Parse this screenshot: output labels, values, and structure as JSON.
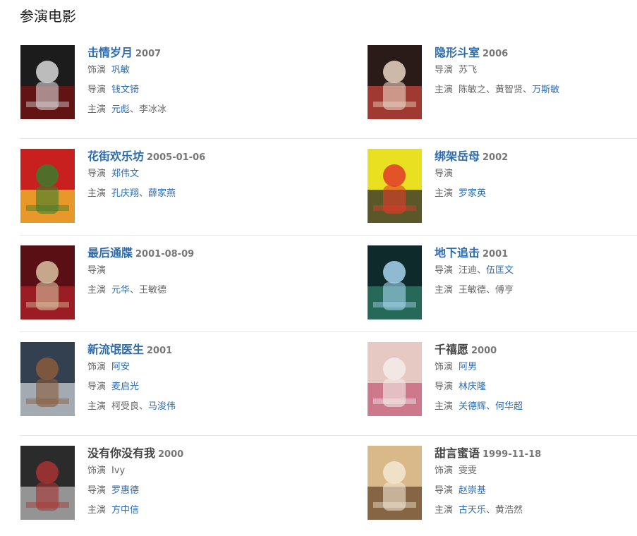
{
  "section_title": "参演电影",
  "rows": [
    {
      "items": [
        {
          "poster_icon": "movie-poster-icon",
          "poster_colors": [
            "#1c1c1c",
            "#7a1010",
            "#d8d8d8"
          ],
          "title": "击情岁月",
          "title_is_link": true,
          "year": "2007",
          "roles": [
            {
              "label": "饰演",
              "people": [
                {
                  "name": "巩敏",
                  "link": true
                }
              ]
            },
            {
              "label": "导演",
              "people": [
                {
                  "name": "钱文锜",
                  "link": true
                }
              ]
            },
            {
              "label": "主演",
              "people": [
                {
                  "name": "元彪",
                  "link": true
                },
                {
                  "name": "李冰冰",
                  "link": false
                }
              ]
            }
          ]
        },
        {
          "poster_icon": "movie-poster-icon",
          "poster_colors": [
            "#2a1a18",
            "#c8443a",
            "#e9d6c4"
          ],
          "title": "隐形斗室",
          "title_is_link": true,
          "year": "2006",
          "roles": [
            {
              "label": "导演",
              "people": [
                {
                  "name": "苏飞",
                  "link": false
                }
              ]
            },
            {
              "label": "主演",
              "people": [
                {
                  "name": "陈敏之",
                  "link": false
                },
                {
                  "name": "黄智贤",
                  "link": false
                },
                {
                  "name": "万斯敏",
                  "link": true
                }
              ]
            }
          ]
        }
      ]
    },
    {
      "items": [
        {
          "poster_icon": "movie-poster-icon",
          "poster_colors": [
            "#c81f1f",
            "#f2c12e",
            "#3b7d2b"
          ],
          "title": "花街欢乐坊",
          "title_is_link": true,
          "year": "2005-01-06",
          "roles": [
            {
              "label": "导演",
              "people": [
                {
                  "name": "郑伟文",
                  "link": true
                }
              ]
            },
            {
              "label": "主演",
              "people": [
                {
                  "name": "孔庆翔",
                  "link": true
                },
                {
                  "name": "薛家燕",
                  "link": true
                }
              ]
            }
          ]
        },
        {
          "poster_icon": "movie-poster-icon",
          "poster_colors": [
            "#e8e020",
            "#2b2b2b",
            "#e23a2a"
          ],
          "title": "绑架岳母",
          "title_is_link": true,
          "year": "2002",
          "roles": [
            {
              "label": "导演",
              "people": []
            },
            {
              "label": "主演",
              "people": [
                {
                  "name": "罗家英",
                  "link": true
                }
              ]
            }
          ]
        }
      ]
    },
    {
      "items": [
        {
          "poster_icon": "movie-poster-icon",
          "poster_colors": [
            "#5a0f14",
            "#b0232a",
            "#d9c2a0"
          ],
          "title": "最后通牒",
          "title_is_link": true,
          "year": "2001-08-09",
          "roles": [
            {
              "label": "导演",
              "people": []
            },
            {
              "label": "主演",
              "people": [
                {
                  "name": "元华",
                  "link": true
                },
                {
                  "name": "王敏德",
                  "link": false
                }
              ]
            }
          ]
        },
        {
          "poster_icon": "movie-poster-icon",
          "poster_colors": [
            "#0e2a2a",
            "#2f7f6a",
            "#a6d4ef"
          ],
          "title": "地下追击",
          "title_is_link": true,
          "year": "2001",
          "roles": [
            {
              "label": "导演",
              "people": [
                {
                  "name": "汪迪",
                  "link": false
                },
                {
                  "name": "伍匡文",
                  "link": true
                }
              ]
            },
            {
              "label": "主演",
              "people": [
                {
                  "name": "王敏德",
                  "link": false
                },
                {
                  "name": "傅亨",
                  "link": false
                }
              ]
            }
          ]
        }
      ]
    },
    {
      "items": [
        {
          "poster_icon": "movie-poster-icon",
          "poster_colors": [
            "#33404f",
            "#c9cdd3",
            "#8a5a3a"
          ],
          "title": "新流氓医生",
          "title_is_link": true,
          "year": "2001",
          "roles": [
            {
              "label": "饰演",
              "people": [
                {
                  "name": "阿安",
                  "link": true
                }
              ]
            },
            {
              "label": "导演",
              "people": [
                {
                  "name": "麦启光",
                  "link": true
                }
              ]
            },
            {
              "label": "主演",
              "people": [
                {
                  "name": "柯受良",
                  "link": false
                },
                {
                  "name": "马浚伟",
                  "link": true
                }
              ]
            }
          ]
        },
        {
          "poster_icon": "movie-poster-icon",
          "poster_colors": [
            "#e7c9c3",
            "#c45c78",
            "#f4ecea"
          ],
          "title": "千禧愿",
          "title_is_link": false,
          "year": "2000",
          "roles": [
            {
              "label": "饰演",
              "people": [
                {
                  "name": "阿男",
                  "link": true
                }
              ]
            },
            {
              "label": "导演",
              "people": [
                {
                  "name": "林庆隆",
                  "link": true
                }
              ]
            },
            {
              "label": "主演",
              "people": [
                {
                  "name": "关德辉",
                  "link": true
                },
                {
                  "name": "何华超",
                  "link": true
                }
              ]
            }
          ]
        }
      ]
    },
    {
      "items": [
        {
          "poster_icon": "movie-poster-icon",
          "poster_colors": [
            "#2b2b2b",
            "#b8b8b8",
            "#a83232"
          ],
          "title": "没有你没有我",
          "title_is_link": false,
          "year": "2000",
          "roles": [
            {
              "label": "饰演",
              "people": [
                {
                  "name": "Ivy",
                  "link": false
                }
              ]
            },
            {
              "label": "导演",
              "people": [
                {
                  "name": "罗惠德",
                  "link": true
                }
              ]
            },
            {
              "label": "主演",
              "people": [
                {
                  "name": "方中信",
                  "link": true
                }
              ]
            }
          ]
        },
        {
          "poster_icon": "movie-poster-icon",
          "poster_colors": [
            "#d9b98a",
            "#6a4a2e",
            "#f2e6d2"
          ],
          "title": "甜言蜜语",
          "title_is_link": false,
          "year": "1999-11-18",
          "roles": [
            {
              "label": "饰演",
              "people": [
                {
                  "name": "雯雯",
                  "link": false
                }
              ]
            },
            {
              "label": "导演",
              "people": [
                {
                  "name": "赵崇基",
                  "link": true
                }
              ]
            },
            {
              "label": "主演",
              "people": [
                {
                  "name": "古天乐",
                  "link": true
                },
                {
                  "name": "黄浩然",
                  "link": false
                }
              ]
            }
          ]
        }
      ]
    }
  ]
}
